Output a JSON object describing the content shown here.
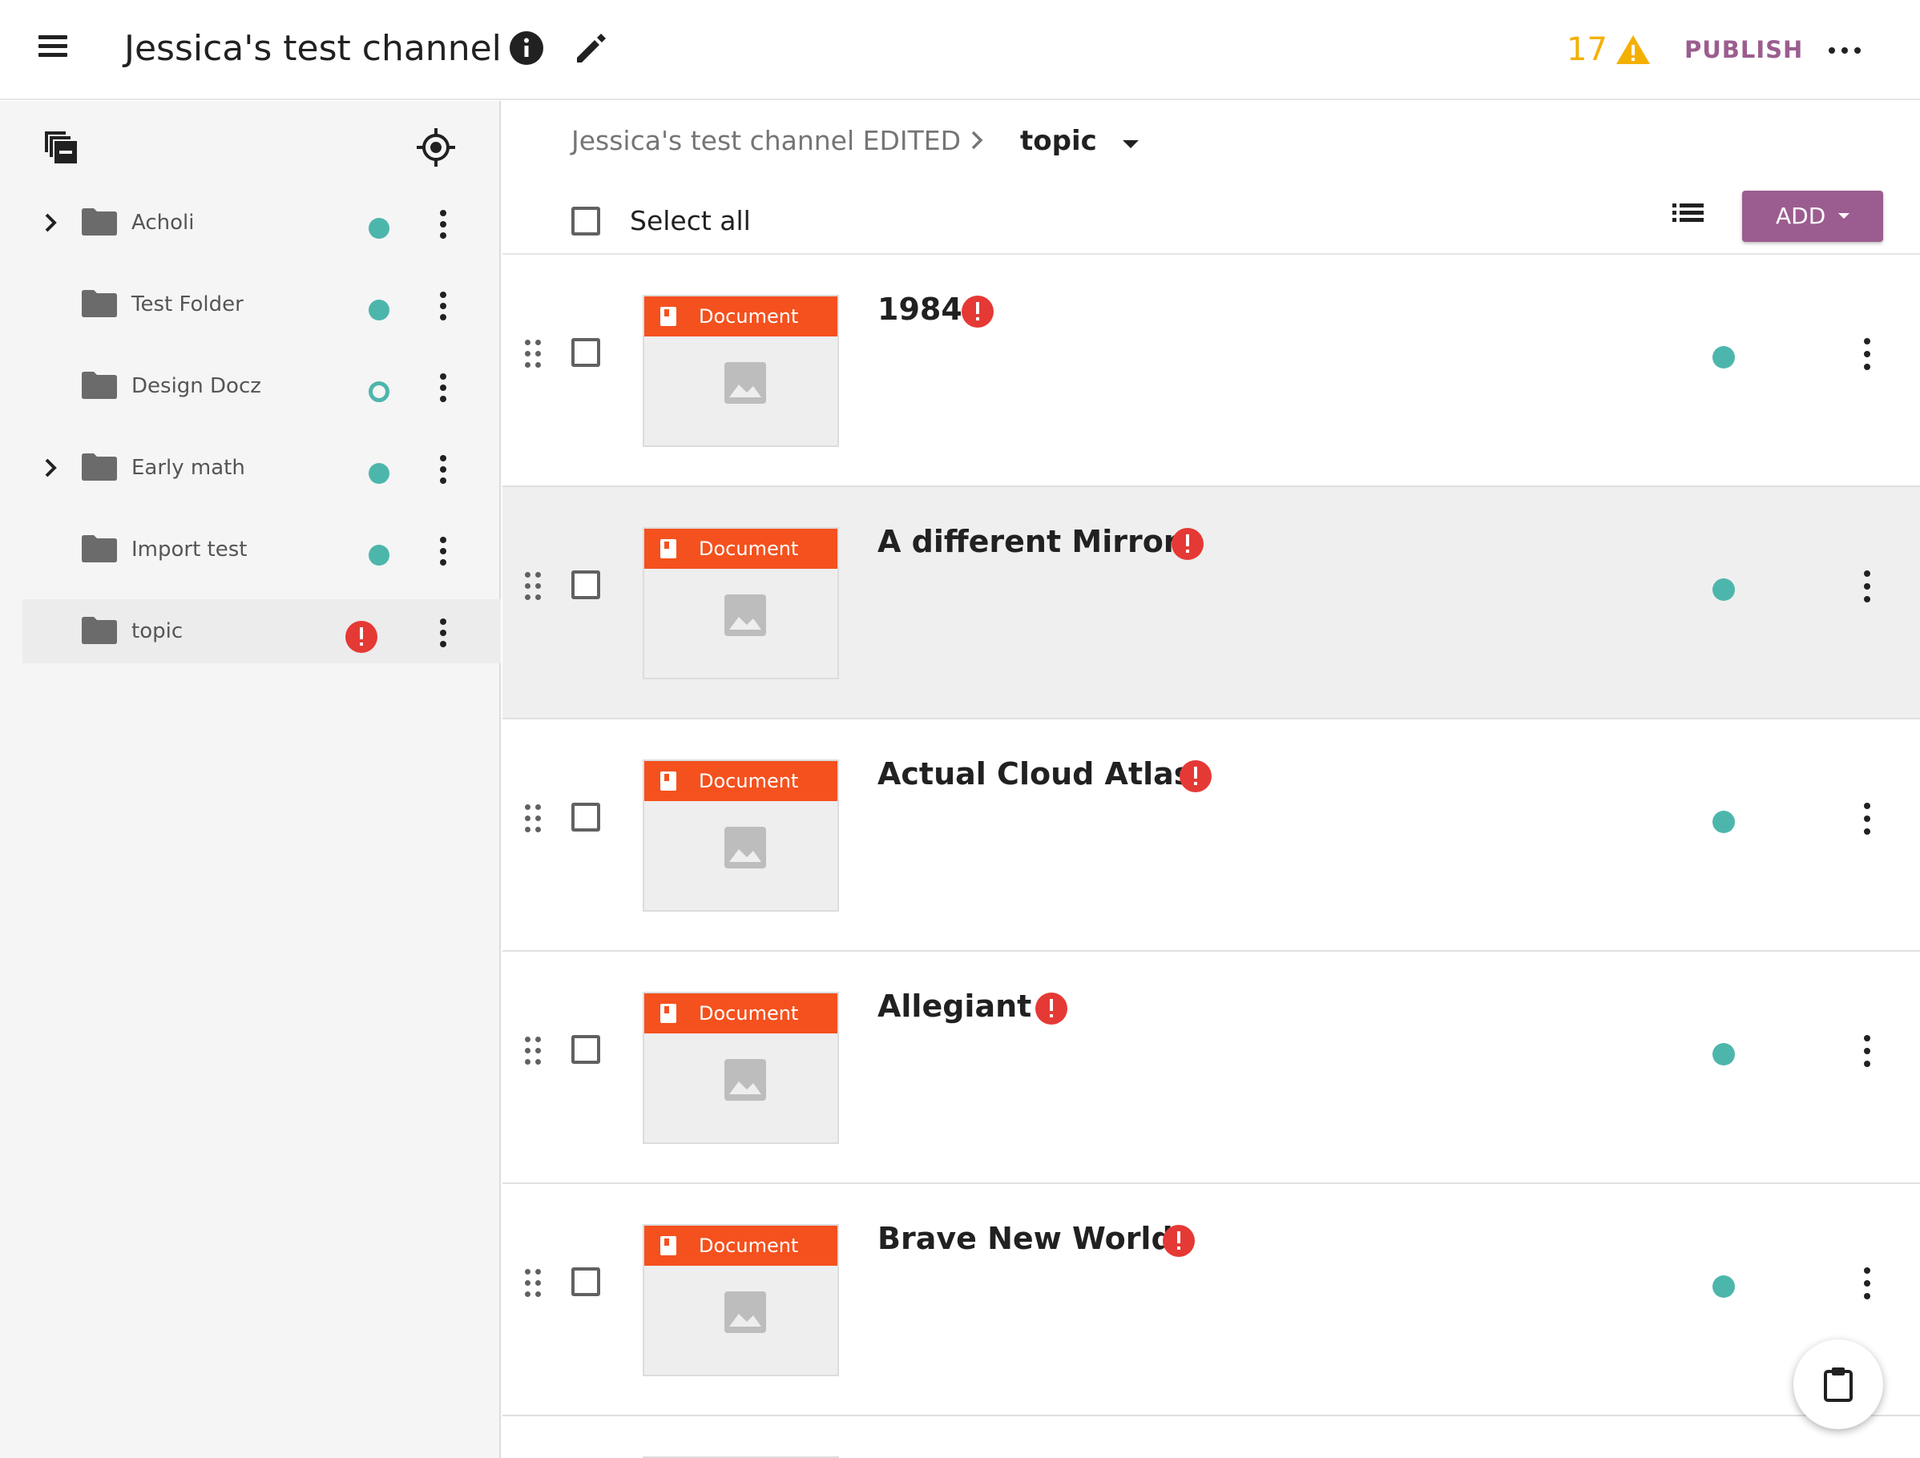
{
  "header": {
    "title": "Jessica's test channel",
    "issue_count": "17",
    "publish_label": "PUBLISH"
  },
  "colors": {
    "accent": "#9b5d8f",
    "warning": "#f4b000",
    "status_ok": "#4db6ac",
    "error": "#e53935",
    "document_badge": "#f4511e"
  },
  "sidebar": {
    "items": [
      {
        "label": "Acholi",
        "expandable": true,
        "status": "published"
      },
      {
        "label": "Test Folder",
        "expandable": false,
        "status": "published"
      },
      {
        "label": "Design Docz",
        "expandable": false,
        "status": "partial"
      },
      {
        "label": "Early math",
        "expandable": true,
        "status": "published"
      },
      {
        "label": "Import test",
        "expandable": false,
        "status": "published"
      },
      {
        "label": "topic",
        "expandable": false,
        "status": "error",
        "active": true
      }
    ]
  },
  "breadcrumb": {
    "root": "Jessica's test channel EDITED",
    "current": "topic"
  },
  "toolbar": {
    "select_all_label": "Select all",
    "add_label": "ADD"
  },
  "content": {
    "items": [
      {
        "kind": "Document",
        "title": "1984",
        "has_error": true
      },
      {
        "kind": "Document",
        "title": "A different Mirror",
        "has_error": true
      },
      {
        "kind": "Document",
        "title": "Actual Cloud Atlas",
        "has_error": true
      },
      {
        "kind": "Document",
        "title": "Allegiant",
        "has_error": true
      },
      {
        "kind": "Document",
        "title": "Brave New World",
        "has_error": true
      }
    ]
  },
  "icons": {
    "menu": "hamburger-icon",
    "info": "info-icon",
    "edit": "pencil-icon",
    "warning": "warning-triangle-icon",
    "more": "more-horizontal-icon",
    "collapse_all": "collapse-all-icon",
    "locate": "crosshair-icon",
    "list_view": "list-view-icon",
    "clipboard": "clipboard-icon"
  }
}
